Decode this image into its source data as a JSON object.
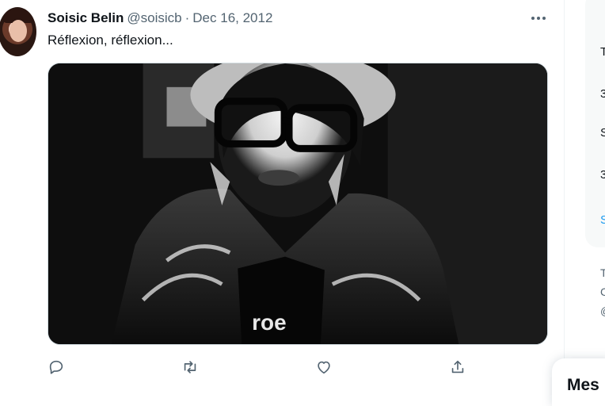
{
  "tweet": {
    "display_name": "Soisic Belin",
    "handle": "@soisicb",
    "separator": "·",
    "date": "Dec 16, 2012",
    "text": "Réflexion, réflexion..."
  },
  "icons": {
    "more": "more-horizontal-icon",
    "reply": "reply-bubble-icon",
    "retweet": "retweet-icon",
    "like": "heart-icon",
    "share": "share-upload-icon"
  },
  "sidebar_fragments": [
    "T",
    "3",
    "S",
    "3",
    "S"
  ],
  "sidebar_footer_fragments": [
    "T",
    "C",
    "@"
  ],
  "messages_drawer": {
    "label": "Mes"
  },
  "colors": {
    "text": "#0f1419",
    "muted": "#536471",
    "accent": "#1d9bf0",
    "border": "#cfd9de"
  }
}
